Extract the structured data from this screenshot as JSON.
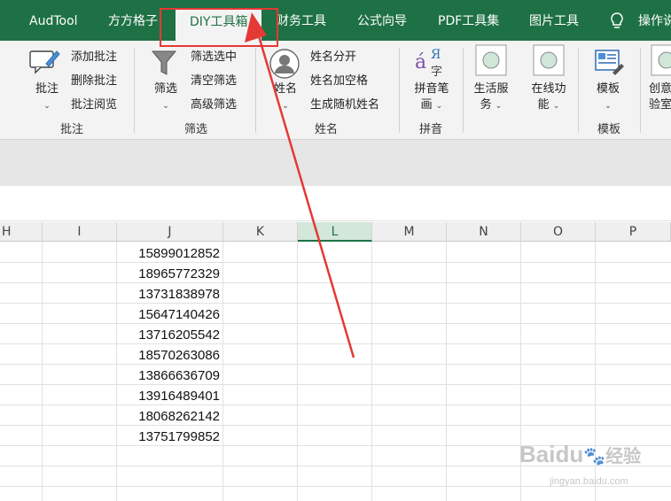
{
  "tabs": [
    {
      "label": "AudTool",
      "active": false
    },
    {
      "label": "方方格子",
      "active": false
    },
    {
      "label": "DIY工具箱",
      "active": true
    },
    {
      "label": "财务工具",
      "active": false
    },
    {
      "label": "公式向导",
      "active": false
    },
    {
      "label": "PDF工具集",
      "active": false
    },
    {
      "label": "图片工具",
      "active": false
    }
  ],
  "tell_me": "操作说",
  "ribbon": {
    "comment": {
      "big": "批注",
      "items": [
        "添加批注",
        "删除批注",
        "批注阅览"
      ],
      "group": "批注"
    },
    "filter": {
      "big": "筛选",
      "items": [
        "筛选选中",
        "清空筛选",
        "高级筛选"
      ],
      "group": "筛选"
    },
    "name": {
      "big": "姓名",
      "items": [
        "姓名分开",
        "姓名加空格",
        "生成随机姓名"
      ],
      "group": "姓名"
    },
    "pinyin": {
      "big_line1": "拼音笔",
      "big_line2": "画",
      "group": "拼音",
      "icon_a": "á",
      "icon_b": "Я",
      "icon_c": "字"
    },
    "life": {
      "line1": "生活服",
      "line2": "务"
    },
    "online": {
      "line1": "在线功",
      "line2": "能"
    },
    "template": {
      "big": "模板",
      "group": "模板"
    },
    "creative": {
      "line1": "创意",
      "line2": "验室"
    }
  },
  "columns": [
    "H",
    "I",
    "J",
    "K",
    "L",
    "M",
    "N",
    "O",
    "P"
  ],
  "selected_column": "L",
  "phones": [
    "15899012852",
    "18965772329",
    "13731838978",
    "15647140426",
    "13716205542",
    "18570263086",
    "13866636709",
    "13916489401",
    "18068262142",
    "13751799852"
  ],
  "watermark": {
    "brand": "Baidu",
    "brand_cn": "经验",
    "url": "jingyan.baidu.com"
  },
  "colors": {
    "accent": "#1e7145",
    "annotation": "#e53935"
  }
}
